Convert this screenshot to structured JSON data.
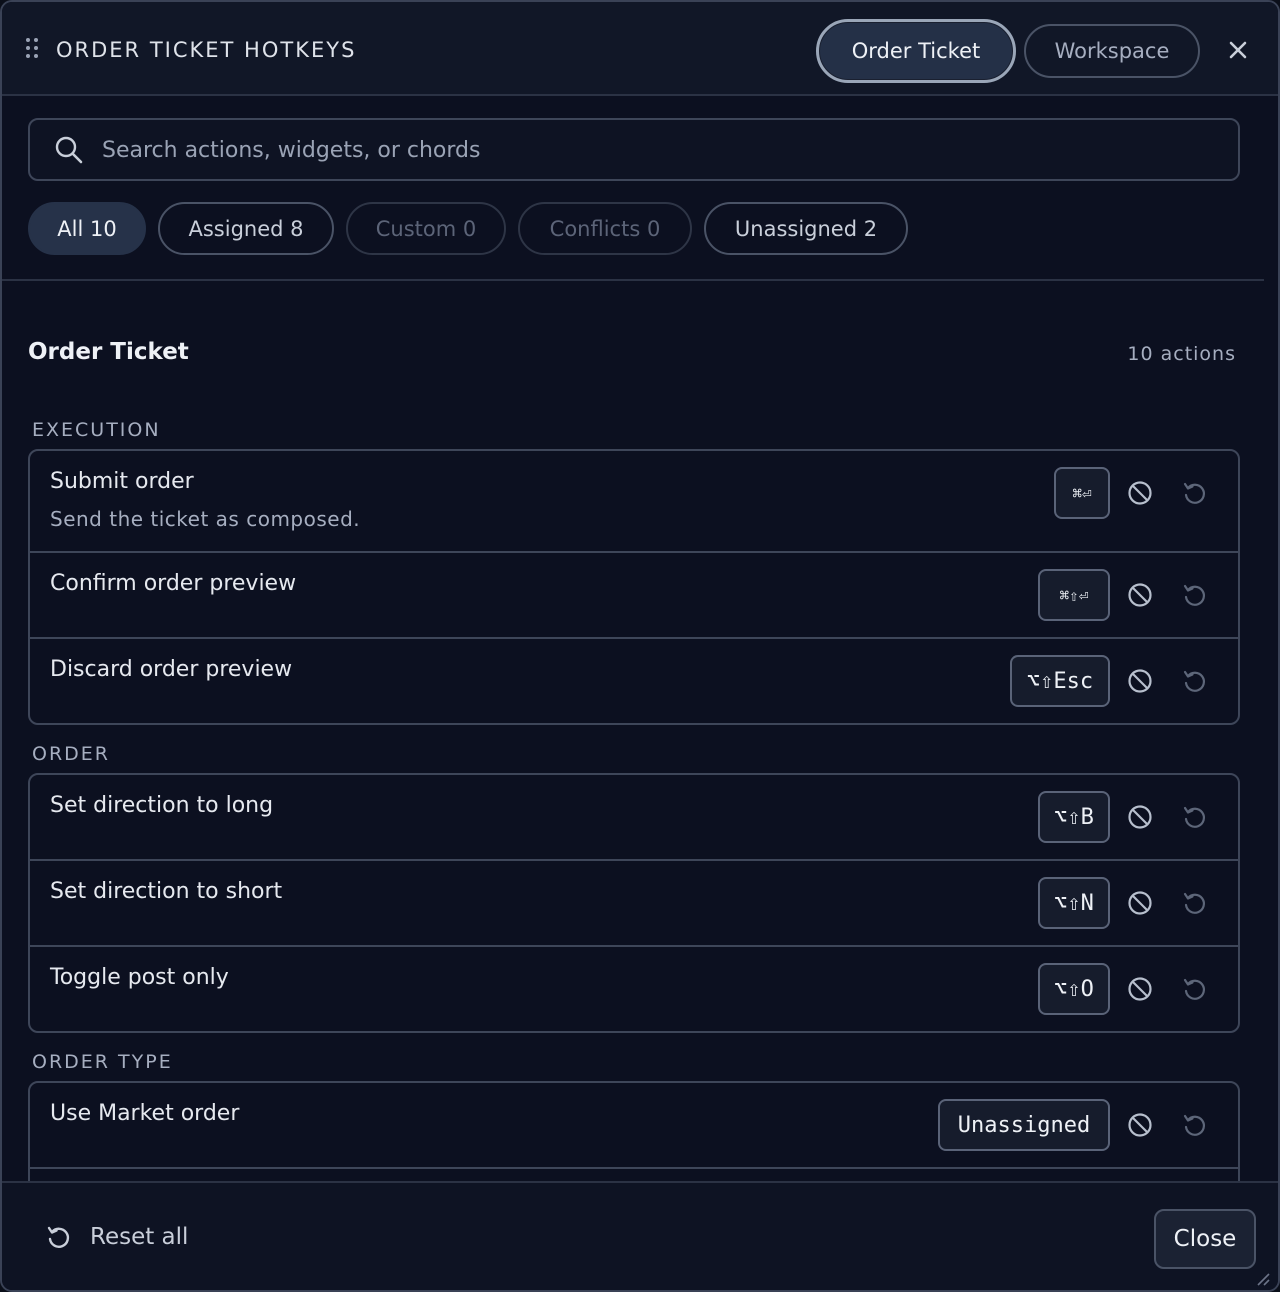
{
  "header": {
    "title": "ORDER TICKET HOTKEYS",
    "scopes": [
      {
        "label": "Order Ticket",
        "active": true
      },
      {
        "label": "Workspace",
        "active": false
      }
    ]
  },
  "search": {
    "placeholder": "Search actions, widgets, or chords",
    "value": ""
  },
  "filters": [
    {
      "label": "All 10",
      "state": "active"
    },
    {
      "label": "Assigned 8",
      "state": "normal"
    },
    {
      "label": "Custom 0",
      "state": "disabled"
    },
    {
      "label": "Conflicts 0",
      "state": "disabled"
    },
    {
      "label": "Unassigned 2",
      "state": "normal"
    }
  ],
  "section": {
    "title": "Order Ticket",
    "count": "10 actions"
  },
  "groups": [
    {
      "label": "EXECUTION",
      "rows": [
        {
          "title": "Submit order",
          "desc": "Send the ticket as composed.",
          "chord": "⌘⏎"
        },
        {
          "title": "Confirm order preview",
          "desc": "",
          "chord": "⌘⇧⏎"
        },
        {
          "title": "Discard order preview",
          "desc": "",
          "chord": "⌥⇧Esc"
        }
      ]
    },
    {
      "label": "ORDER",
      "rows": [
        {
          "title": "Set direction to long",
          "desc": "",
          "chord": "⌥⇧B"
        },
        {
          "title": "Set direction to short",
          "desc": "",
          "chord": "⌥⇧N"
        },
        {
          "title": "Toggle post only",
          "desc": "",
          "chord": "⌥⇧O"
        }
      ]
    },
    {
      "label": "ORDER TYPE",
      "rows": [
        {
          "title": "Use Market order",
          "desc": "",
          "chord": "Unassigned"
        }
      ]
    }
  ],
  "footer": {
    "reset_label": "Reset all",
    "close_label": "Close"
  },
  "colors": {
    "accent": "#243047",
    "border": "#3e4659",
    "text": "#e6e9ef",
    "muted": "#a6aec0"
  },
  "icons": {
    "drag": "drag-handle-icon",
    "close": "close-icon",
    "search": "search-icon",
    "disable": "block-icon",
    "reset": "reset-icon"
  }
}
